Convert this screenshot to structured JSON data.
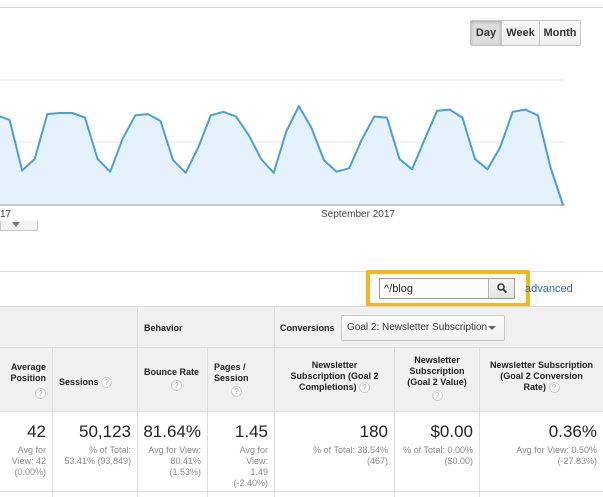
{
  "range_toggle": {
    "day": "Day",
    "week": "Week",
    "month": "Month",
    "active": "Day"
  },
  "chart_data": {
    "type": "area",
    "x_labels": [
      "17",
      "September 2017"
    ],
    "series_color": "#4a9fd5",
    "fill_color": "#e6f2fb",
    "ylim": [
      0,
      1
    ],
    "values": [
      0.78,
      0.74,
      0.3,
      0.4,
      0.79,
      0.8,
      0.8,
      0.76,
      0.4,
      0.29,
      0.58,
      0.78,
      0.79,
      0.73,
      0.39,
      0.28,
      0.5,
      0.78,
      0.81,
      0.77,
      0.61,
      0.4,
      0.28,
      0.64,
      0.86,
      0.67,
      0.39,
      0.29,
      0.32,
      0.57,
      0.77,
      0.76,
      0.4,
      0.31,
      0.57,
      0.82,
      0.83,
      0.76,
      0.4,
      0.31,
      0.5,
      0.81,
      0.83,
      0.78,
      0.33,
      0.0
    ]
  },
  "search": {
    "value": "^/blog",
    "advanced": "advanced"
  },
  "table": {
    "group_behavior": "Behavior",
    "group_conversions": "Conversions",
    "goal_select": "Goal 2: Newsletter Subscription",
    "headers": {
      "avg_position": "Average Position",
      "sessions": "Sessions",
      "bounce_rate": "Bounce Rate",
      "pages_session": "Pages / Session",
      "nl_completions": "Newsletter Subscription (Goal 2 Completions)",
      "nl_value": "Newsletter Subscription (Goal 2 Value)",
      "nl_conv_rate": "Newsletter Subscription (Goal 2 Conversion Rate)"
    },
    "totals": {
      "avg_position": {
        "value": "42",
        "sub1": "Avg for",
        "sub2": "View: 42",
        "sub3": "(0.00%)"
      },
      "sessions": {
        "value": "50,123",
        "sub1": "% of Total:",
        "sub2": "53.41% (93,849)"
      },
      "bounce_rate": {
        "value": "81.64%",
        "sub1": "Avg for View:",
        "sub2": "80.41%",
        "sub3": "(1.53%)"
      },
      "pages_session": {
        "value": "1.45",
        "sub1": "Avg for",
        "sub2": "View:",
        "sub3": "1.49",
        "sub4": "(-2.40%)"
      },
      "nl_completions": {
        "value": "180",
        "sub1": "% of Total: 38.54%",
        "sub2": "(467)"
      },
      "nl_value": {
        "value": "$0.00",
        "sub1": "% of Total: 0.00%",
        "sub2": "($0.00)"
      },
      "nl_conv_rate": {
        "value": "0.36%",
        "sub1": "Avg for View: 0.50%",
        "sub2": "(-27.83%)"
      }
    }
  }
}
